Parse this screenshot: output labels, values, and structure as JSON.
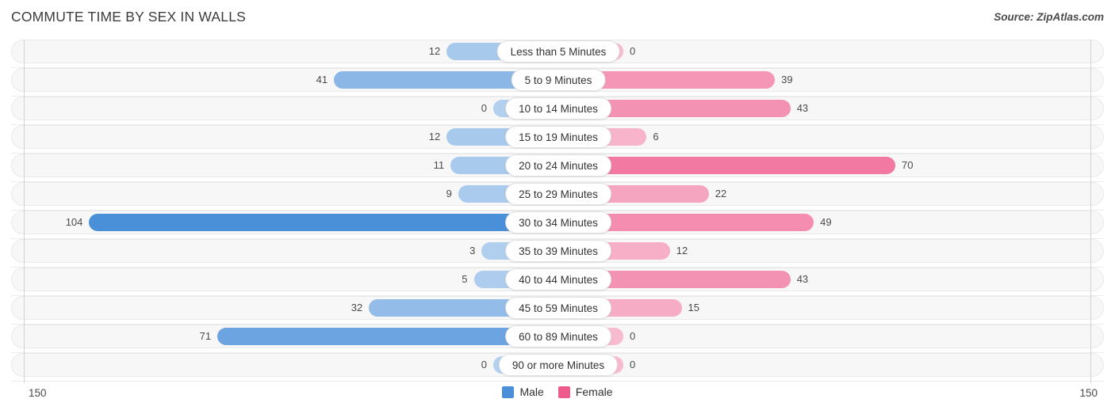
{
  "header": {
    "title": "COMMUTE TIME BY SEX IN WALLS",
    "source": "Source: ZipAtlas.com"
  },
  "axis": {
    "min_label": "150",
    "max_label": "150",
    "max_value": 150
  },
  "legend": {
    "items": [
      {
        "label": "Male",
        "color": "#4a90d9"
      },
      {
        "label": "Female",
        "color": "#ef5a8c"
      }
    ]
  },
  "colors": {
    "male": "#4a90d9",
    "female": "#ef5a8c",
    "track": "#f7f7f7",
    "track_border": "#eaeaea",
    "axis_line": "#d2d2d2",
    "label_text": "#4a4a4a"
  },
  "chart_data": {
    "type": "bar",
    "subtype": "diverging-bidirectional",
    "title": "COMMUTE TIME BY SEX IN WALLS",
    "xlabel": "",
    "ylabel": "",
    "xlim": [
      150,
      150
    ],
    "grid": false,
    "legend_position": "bottom-center",
    "categories": [
      "Less than 5 Minutes",
      "5 to 9 Minutes",
      "10 to 14 Minutes",
      "15 to 19 Minutes",
      "20 to 24 Minutes",
      "25 to 29 Minutes",
      "30 to 34 Minutes",
      "35 to 39 Minutes",
      "40 to 44 Minutes",
      "45 to 59 Minutes",
      "60 to 89 Minutes",
      "90 or more Minutes"
    ],
    "series": [
      {
        "name": "Male",
        "direction": "left",
        "color": "#4a90d9",
        "values": [
          12,
          41,
          0,
          12,
          11,
          9,
          104,
          3,
          5,
          32,
          71,
          0
        ]
      },
      {
        "name": "Female",
        "direction": "right",
        "color": "#ef5a8c",
        "values": [
          0,
          39,
          43,
          6,
          70,
          22,
          49,
          12,
          43,
          15,
          0,
          0
        ]
      }
    ]
  }
}
